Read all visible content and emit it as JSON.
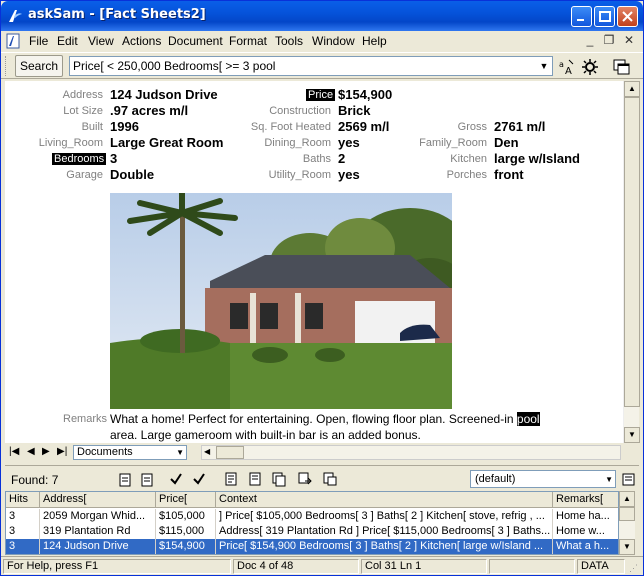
{
  "window": {
    "title": "askSam - [Fact Sheets2]"
  },
  "menu": {
    "items": [
      "File",
      "Edit",
      "View",
      "Actions",
      "Document",
      "Format",
      "Tools",
      "Window",
      "Help"
    ]
  },
  "toolbar": {
    "search_label": "Search",
    "query": "Price[ < 250,000  Bedrooms[ >= 3  pool"
  },
  "record": {
    "address_label": "Address",
    "address": "124 Judson Drive",
    "price_label": "Price",
    "price": "$154,900",
    "lot_label": "Lot Size",
    "lot": ".97 acres m/l",
    "construction_label": "Construction",
    "construction": "Brick",
    "built_label": "Built",
    "built": "1996",
    "sqft_label": "Sq. Foot Heated",
    "sqft": "2569 m/l",
    "gross_label": "Gross",
    "gross": "2761 m/l",
    "living_label": "Living_Room",
    "living": "Large Great Room",
    "dining_label": "Dining_Room",
    "dining": "yes",
    "family_label": "Family_Room",
    "family": "Den",
    "bedrooms_label": "Bedrooms",
    "bedrooms": "3",
    "baths_label": "Baths",
    "baths": "2",
    "kitchen_label": "Kitchen",
    "kitchen": "large w/Island",
    "garage_label": "Garage",
    "garage": "Double",
    "utility_label": "Utility_Room",
    "utility": "yes",
    "porches_label": "Porches",
    "porches": "front",
    "remarks_label": "Remarks",
    "remarks_a": "What a home! Perfect for entertaining. Open, flowing floor plan. Screened-in ",
    "remarks_hl": "pool",
    "remarks_b": "area. Large gameroom with built-in bar is an added bonus."
  },
  "nav": {
    "document_type": "Documents"
  },
  "found": {
    "label": "Found: 7",
    "view": "(default)"
  },
  "results": {
    "columns": [
      "Hits",
      "Address[",
      "Price[",
      "Context",
      "Remarks["
    ],
    "rows": [
      [
        "3",
        "2059 Morgan Whid...",
        "$105,000",
        "]  Price[ $105,000  Bedrooms[ 3 ] Baths[ 2 ] Kitchen[ stove, refrig , ...",
        "Home ha..."
      ],
      [
        "3",
        "319 Plantation Rd",
        "$115,000",
        "Address[ 319 Plantation Rd ]  Price[ $115,000  Bedrooms[ 3 ] Baths...",
        "Home w..."
      ],
      [
        "3",
        "124 Judson Drive",
        "$154,900",
        "Price[ $154,900  Bedrooms[ 3 ] Baths[ 2 ] Kitchen[ large w/Island  ...",
        "What a h..."
      ]
    ]
  },
  "status": {
    "help": "For Help, press F1",
    "doc": "Doc 4 of 48",
    "pos": "Col 31  Ln 1",
    "mode": "DATA"
  }
}
